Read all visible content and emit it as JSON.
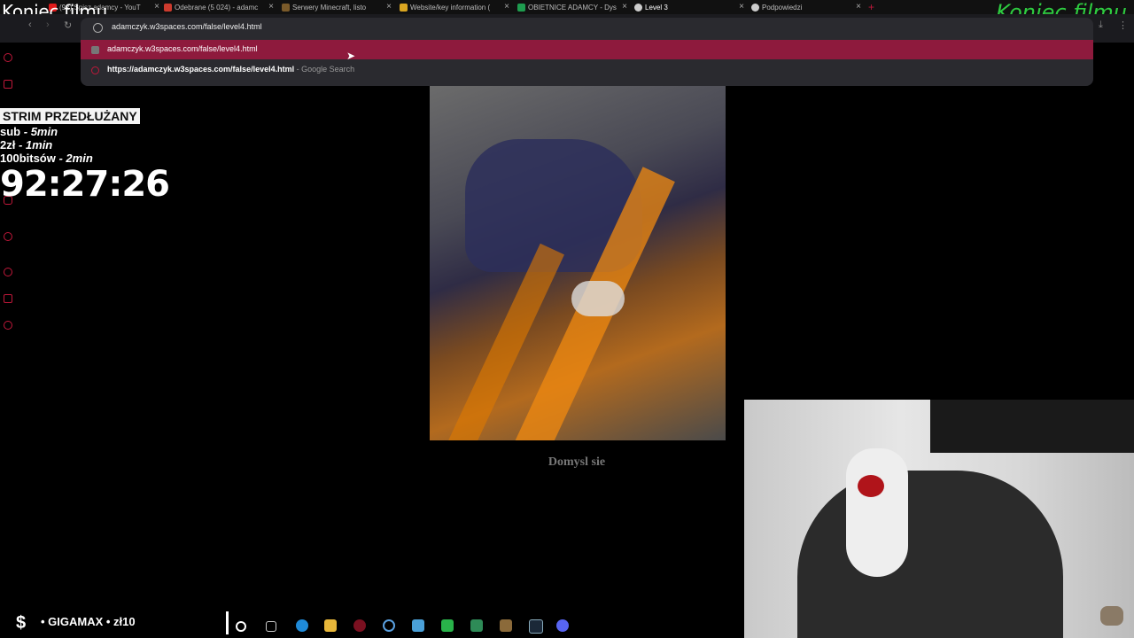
{
  "overlays": {
    "top_left": "Koniec filmu",
    "top_right": "Koniec filmu"
  },
  "tabs": [
    {
      "label": "(92) Spisz adamcy - YouT",
      "color": "#e01b1b"
    },
    {
      "label": "Odebrane (5 024) - adamc",
      "color": "#cc3b2e"
    },
    {
      "label": "Serwery Minecraft, listo",
      "color": "#7a5a2a"
    },
    {
      "label": "Website/key information (",
      "color": "#d9a521"
    },
    {
      "label": "OBIETNICE ADAMCY - Dys",
      "color": "#1e9c4f"
    },
    {
      "label": "Level 3",
      "color": "#cccccc"
    },
    {
      "label": "Podpowiedzi",
      "color": "#cccccc"
    }
  ],
  "address": {
    "url": "adamczyk.w3spaces.com/false/level4.html",
    "suggestion_url": "adamczyk.w3spaces.com/false/level4.html",
    "search_text": "https://adamczyk.w3spaces.com/false/level4.html",
    "search_suffix": "- Google Search"
  },
  "stream": {
    "title": "STRIM PRZEDŁUŻANY",
    "sub_label": "sub",
    "sub_value": "- 5min",
    "zl_label": "2zł",
    "zl_value": "- 1min",
    "bits_label": "100bitsów",
    "bits_value": "- 2min",
    "timer": "92:27:26"
  },
  "page": {
    "caption": "Domysl sie"
  },
  "taskbar": {
    "symbol": "$",
    "donor": "• GIGAMAX • zł10"
  },
  "colors": {
    "accent": "#c0183a",
    "suggestion_highlight": "#8e1a3d",
    "overlay_green": "#2ecc40"
  }
}
